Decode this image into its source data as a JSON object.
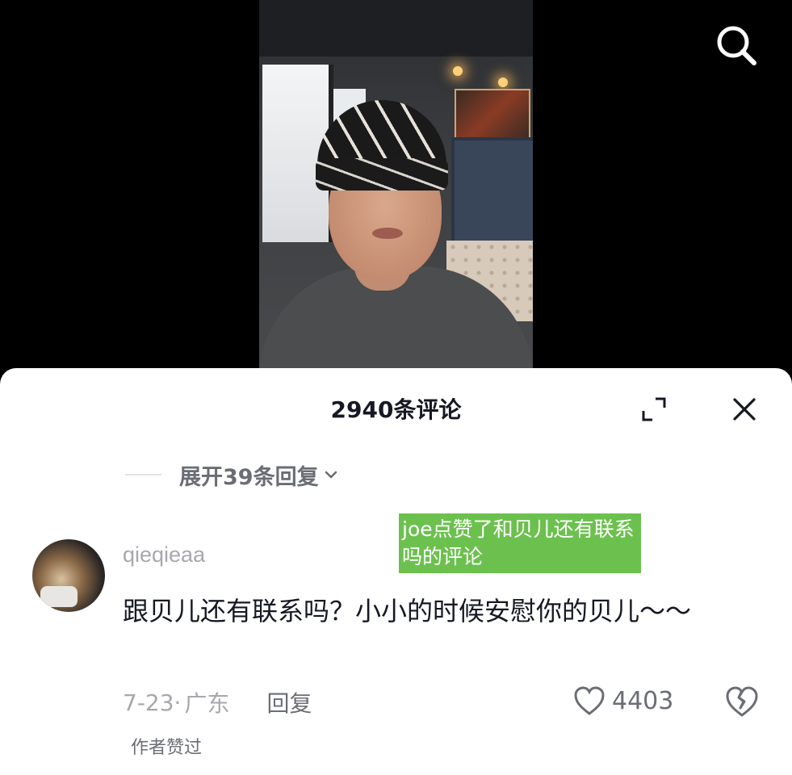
{
  "icons": {
    "search": "search-icon",
    "expand": "expand-icon",
    "close": "close-icon",
    "chevron": "chevron-down-icon",
    "like": "heart-outline-icon",
    "dislike": "broken-heart-icon"
  },
  "colors": {
    "sheet_bg": "#ffffff",
    "title": "#161823",
    "secondary": "#a7a8ad",
    "liked_note_bg": "#6cc14e"
  },
  "sheet": {
    "title": "2940条评论",
    "expand_replies": "展开39条回复"
  },
  "comment": {
    "username": "qieqieaa",
    "liked_note": "joe点赞了和贝儿还有联系吗的评论",
    "text": "跟贝儿还有联系吗？小小的时候安慰你的贝儿～～",
    "date": "7-23·",
    "location": "广东",
    "reply_label": "回复",
    "like_count": "4403",
    "author_liked": "作者赞过"
  }
}
